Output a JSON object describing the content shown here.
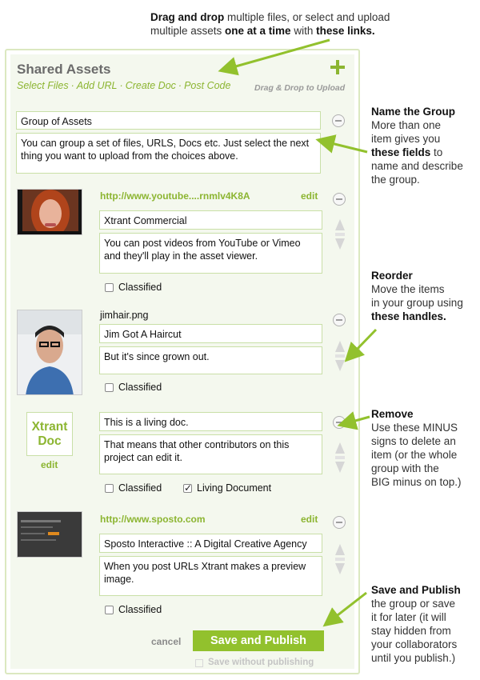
{
  "notes": {
    "top": {
      "line1_bold": "Drag and drop",
      "line1_rest": " multiple files, or select and upload",
      "line2_pre": "multiple assets ",
      "line2_bold1": "one at a time",
      "line2_mid": " with ",
      "line2_bold2": "these links."
    },
    "name_group": {
      "heading": "Name the Group",
      "l1": "More than one",
      "l2": "item gives you",
      "l3_bold": "these fields",
      "l3_rest": " to",
      "l4": "name and describe",
      "l5": "the group."
    },
    "reorder": {
      "heading": "Reorder",
      "l1": "Move the items",
      "l2": "in your group using",
      "l3_bold": "these handles."
    },
    "remove": {
      "heading": "Remove",
      "l1": "Use these MINUS",
      "l2": "signs to delete an",
      "l3": "item  (or the whole",
      "l4": "group with the",
      "l5": "BIG minus on top.)"
    },
    "save": {
      "heading": "Save and Publish",
      "l1": "the group or save",
      "l2": "it for later (it will",
      "l3": "stay hidden from",
      "l4": "your collaborators",
      "l5": "until you publish.)"
    }
  },
  "panel": {
    "title": "Shared Assets",
    "links": [
      "Select Files",
      "Add URL",
      "Create Doc",
      "Post Code"
    ],
    "drag_drop": "Drag & Drop to Upload",
    "group_name": "Group of Assets",
    "group_desc": "You can group a set of files, URLS, Docs etc.  Just select the next thing you want to upload from the choices above."
  },
  "items": [
    {
      "source": "http://www.youtube....rnmlv4K8A",
      "edit": "edit",
      "title": "Xtrant Commercial",
      "desc": "You can post videos from YouTube or Vimeo and they'll play in the asset viewer.",
      "classified_label": "Classified"
    },
    {
      "source": "jimhair.png",
      "title": "Jim Got A Haircut",
      "desc": "But it's since grown out.",
      "classified_label": "Classified"
    },
    {
      "doc_label": "Xtrant Doc",
      "doc_edit": "edit",
      "title": "This is a living doc.",
      "desc": "That means that other contributors on this project can edit it.",
      "classified_label": "Classified",
      "living_label": "Living Document"
    },
    {
      "source": "http://www.sposto.com",
      "edit": "edit",
      "title": "Sposto Interactive :: A Digital Creative Agency",
      "desc": "When you post URLs Xtrant makes a preview image.",
      "classified_label": "Classified"
    }
  ],
  "footer": {
    "cancel": "cancel",
    "save": "Save and Publish",
    "save_without": "Save without publishing"
  },
  "colors": {
    "accent": "#8cb531",
    "button": "#92c12d",
    "panel_bg": "#f4f8ee",
    "field_border": "#c9dfa7"
  },
  "icons": [
    "plus-icon",
    "minus-icon",
    "reorder-handle-icon",
    "arrow-icon"
  ]
}
